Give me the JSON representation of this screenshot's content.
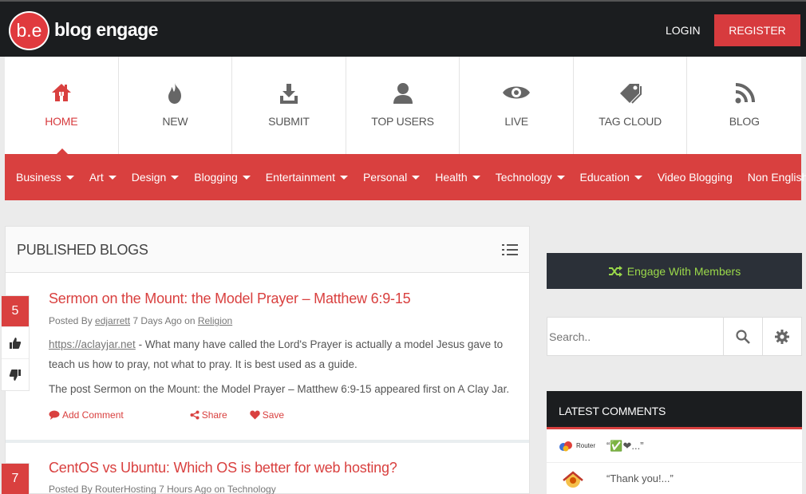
{
  "header": {
    "logo_mark": "b.e",
    "logo_text": "blog engage",
    "login_label": "LOGIN",
    "register_label": "REGISTER"
  },
  "main_nav": [
    {
      "label": "HOME",
      "icon": "home-icon",
      "active": true
    },
    {
      "label": "NEW",
      "icon": "fire-icon"
    },
    {
      "label": "SUBMIT",
      "icon": "download-icon"
    },
    {
      "label": "TOP USERS",
      "icon": "user-icon"
    },
    {
      "label": "LIVE",
      "icon": "eye-icon"
    },
    {
      "label": "TAG CLOUD",
      "icon": "tags-icon"
    },
    {
      "label": "BLOG",
      "icon": "rss-icon"
    }
  ],
  "categories": [
    {
      "label": "Business",
      "dropdown": true
    },
    {
      "label": "Art",
      "dropdown": true
    },
    {
      "label": "Design",
      "dropdown": true
    },
    {
      "label": "Blogging",
      "dropdown": true
    },
    {
      "label": "Entertainment",
      "dropdown": true
    },
    {
      "label": "Personal",
      "dropdown": true
    },
    {
      "label": "Health",
      "dropdown": true
    },
    {
      "label": "Technology",
      "dropdown": true
    },
    {
      "label": "Education",
      "dropdown": true
    },
    {
      "label": "Video Blogging",
      "dropdown": false
    },
    {
      "label": "Non English",
      "dropdown": true
    }
  ],
  "panel": {
    "title": "PUBLISHED BLOGS"
  },
  "posts": [
    {
      "votes": "5",
      "title": "Sermon on the Mount: the Model Prayer – Matthew 6:9-15",
      "posted_by_label": "Posted By",
      "author": "edjarrett",
      "age": "7 Days Ago",
      "on_label": "on",
      "category": "Religion",
      "source_link": "https://aclayjar.net",
      "excerpt": " - What many have called the Lord's Prayer is actually a model Jesus gave to teach us how to pray, not what to pray. It is best used as a guide.",
      "appeared": "The post Sermon on the Mount: the Model Prayer – Matthew 6:9-15 appeared first on A Clay Jar.",
      "actions": {
        "comment": "Add Comment",
        "share": "Share",
        "save": "Save"
      }
    },
    {
      "votes": "7",
      "title": "CentOS vs Ubuntu: Which OS is better for web hosting?",
      "posted_by_label": "Posted By",
      "author": "RouterHosting",
      "age": "7 Hours Ago",
      "on_label": "on",
      "category": "Technology"
    }
  ],
  "sidebar": {
    "engage_label": "Engage With Members",
    "search_placeholder": "Search..",
    "comments_title": "LATEST COMMENTS",
    "comments": [
      {
        "avatar_text": "Router",
        "text": "“✅❤...”"
      },
      {
        "avatar_text": "",
        "text": "“Thank you!...”"
      }
    ]
  },
  "colors": {
    "accent": "#d9403f",
    "topbar": "#1b1d1f",
    "engage_bg": "#2b3038",
    "engage_text": "#9bd94a"
  }
}
